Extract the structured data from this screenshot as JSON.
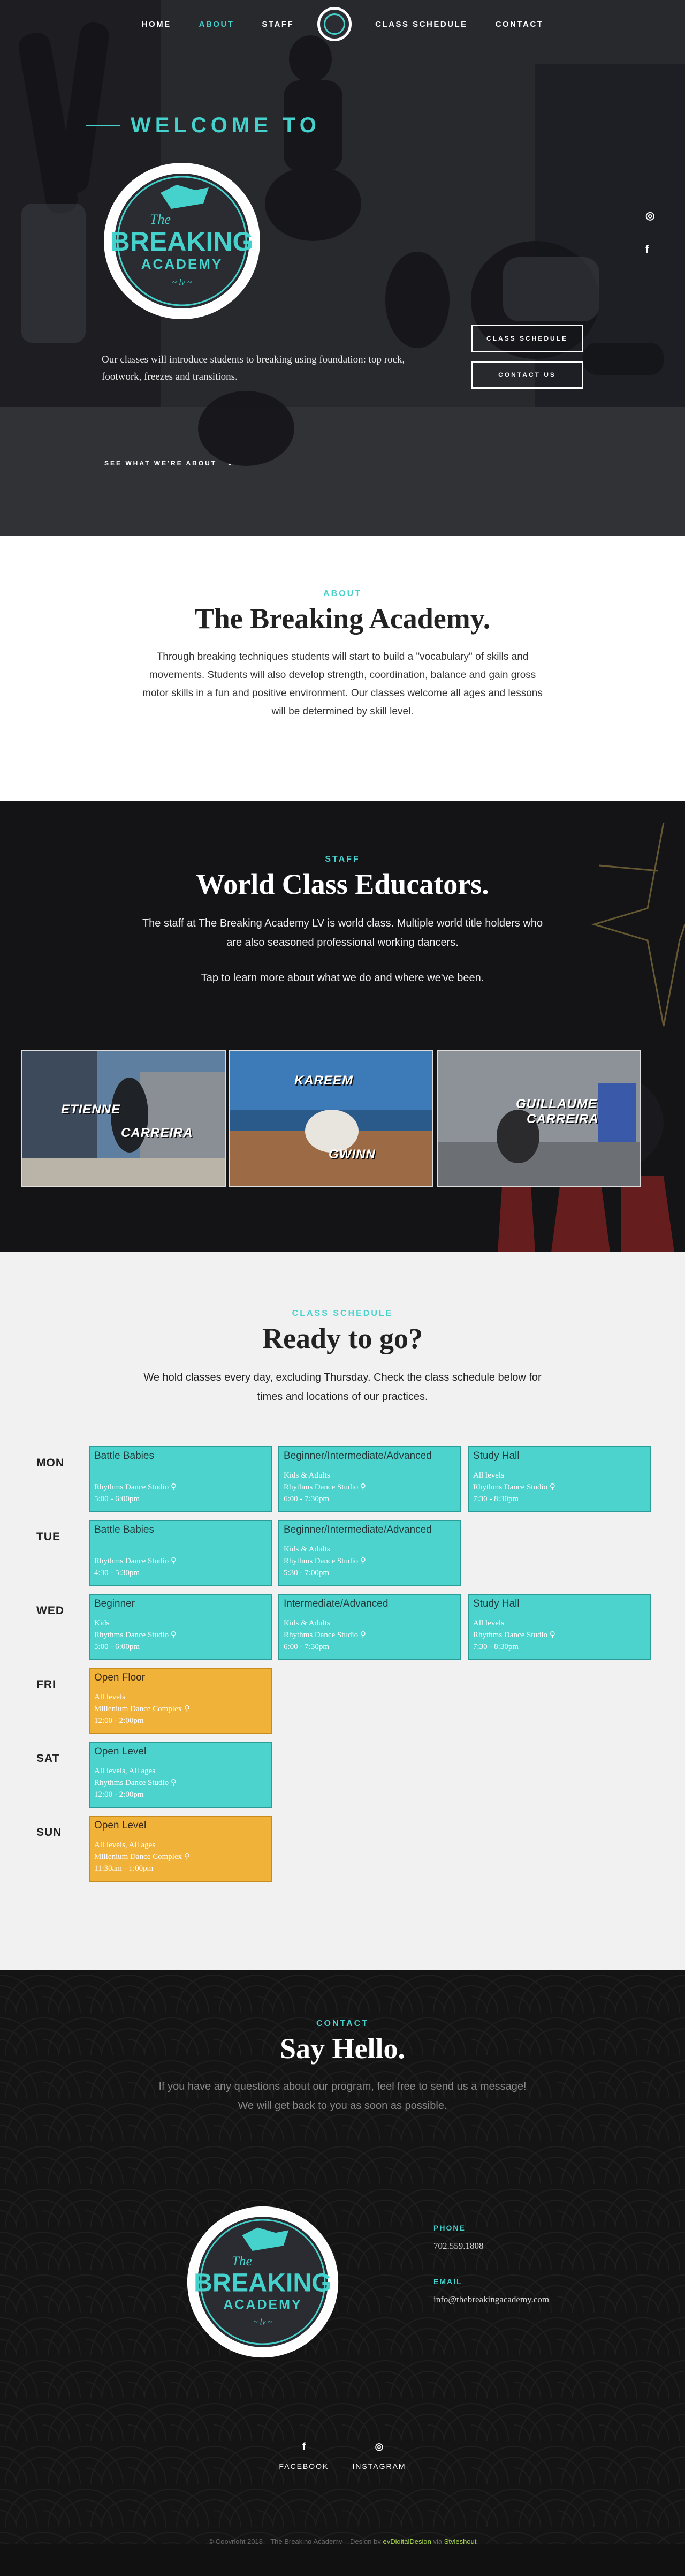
{
  "nav": {
    "items": [
      {
        "label": "HOME",
        "active": false
      },
      {
        "label": "ABOUT",
        "active": true
      },
      {
        "label": "STAFF",
        "active": false
      },
      {
        "label": "CLASS SCHEDULE",
        "active": false
      },
      {
        "label": "CONTACT",
        "active": false
      }
    ],
    "logo_icon": "breaking-academy-badge-icon"
  },
  "hero": {
    "welcome": "WELCOME TO",
    "logo_top": "The",
    "logo_main": "BREAKING",
    "logo_sub": "ACADEMY",
    "logo_tag": "~ lv ~",
    "intro": "Our classes will introduce students to breaking using foundation: top rock, footwork, freezes and transitions.",
    "see_what": "SEE WHAT WE'RE ABOUT",
    "buttons": [
      "CLASS SCHEDULE",
      "CONTACT US"
    ],
    "social_icons": [
      "instagram-icon",
      "facebook-icon"
    ]
  },
  "about": {
    "eyebrow": "ABOUT",
    "title": "The Breaking Academy.",
    "body": "Through breaking techniques students will start to build a \"vocabulary\" of skills and movements. Students will also develop strength, coordination, balance and gain gross motor skills in a fun and positive environment. Our classes welcome all ages and lessons will be determined by skill level."
  },
  "staff": {
    "eyebrow": "STAFF",
    "title": "World Class Educators.",
    "body": "The staff at The Breaking Academy LV is world class. Multiple world title holders who are also seasoned professional working dancers.",
    "tap": "Tap to learn more about what we do and where we've been.",
    "cards": [
      {
        "first": "ETIENNE",
        "last": "CARREIRA"
      },
      {
        "first": "KAREEM",
        "last": "GWINN"
      },
      {
        "first": "GUILLAUME",
        "last": "CARREIRA"
      }
    ]
  },
  "schedule": {
    "eyebrow": "CLASS SCHEDULE",
    "title": "Ready to go?",
    "body": "We hold classes every day, excluding Thursday. Check the class schedule below for times and locations of our practices.",
    "days": [
      {
        "day": "MON",
        "classes": [
          {
            "title": "Battle Babies",
            "lines": [
              "",
              "Rhythms Dance Studio ⚲",
              "5:00 - 6:00pm"
            ],
            "color": "teal"
          },
          {
            "title": "Beginner/Intermediate/Advanced",
            "lines": [
              "Kids & Adults",
              "Rhythms Dance Studio ⚲",
              "6:00 - 7:30pm"
            ],
            "color": "teal"
          },
          {
            "title": "Study Hall",
            "lines": [
              "All levels",
              "Rhythms Dance Studio ⚲",
              "7:30 - 8:30pm"
            ],
            "color": "teal"
          }
        ]
      },
      {
        "day": "TUE",
        "classes": [
          {
            "title": "Battle Babies",
            "lines": [
              "",
              "Rhythms Dance Studio ⚲",
              "4:30 - 5:30pm"
            ],
            "color": "teal"
          },
          {
            "title": "Beginner/Intermediate/Advanced",
            "lines": [
              "Kids & Adults",
              "Rhythms Dance Studio ⚲",
              "5:30 - 7:00pm"
            ],
            "color": "teal"
          }
        ]
      },
      {
        "day": "WED",
        "classes": [
          {
            "title": "Beginner",
            "lines": [
              "Kids",
              "Rhythms Dance Studio ⚲",
              "5:00 - 6:00pm"
            ],
            "color": "teal"
          },
          {
            "title": "Intermediate/Advanced",
            "lines": [
              "Kids & Adults",
              "Rhythms Dance Studio ⚲",
              "6:00 - 7:30pm"
            ],
            "color": "teal"
          },
          {
            "title": "Study Hall",
            "lines": [
              "All levels",
              "Rhythms Dance Studio ⚲",
              "7:30 - 8:30pm"
            ],
            "color": "teal"
          }
        ]
      },
      {
        "day": "FRI",
        "classes": [
          {
            "title": "Open Floor",
            "lines": [
              "All levels",
              "Millenium Dance Complex ⚲",
              "12:00 - 2:00pm"
            ],
            "color": "orange"
          }
        ]
      },
      {
        "day": "SAT",
        "classes": [
          {
            "title": "Open Level",
            "lines": [
              "All levels, All ages",
              "Rhythms Dance Studio ⚲",
              "12:00 - 2:00pm"
            ],
            "color": "teal"
          }
        ]
      },
      {
        "day": "SUN",
        "classes": [
          {
            "title": "Open Level",
            "lines": [
              "All levels, All ages",
              "Millenium Dance Complex ⚲",
              "11:30am - 1:00pm"
            ],
            "color": "orange"
          }
        ]
      }
    ]
  },
  "contact": {
    "eyebrow": "CONTACT",
    "title": "Say Hello.",
    "lead": "If you have any questions about our program, feel free to send us a message! We will get back to you as soon as possible.",
    "phone_label": "PHONE",
    "phone": "702.559.1808",
    "email_label": "EMAIL",
    "email": "info@thebreakingacademy.com",
    "footer_social": [
      {
        "icon": "facebook-icon",
        "glyph": "f",
        "label": "FACEBOOK"
      },
      {
        "icon": "instagram-icon",
        "glyph": "◎",
        "label": "INSTAGRAM"
      }
    ],
    "copyright": "© Copyright 2018 – The Breaking Academy",
    "design_by_prefix": "Design by",
    "designer": "eyDigitalDesign",
    "via": "via",
    "template": "Styleshout"
  },
  "colors": {
    "accent": "#45d1cc",
    "teal_block": "#4dd3cd",
    "orange_block": "#f1b239"
  }
}
